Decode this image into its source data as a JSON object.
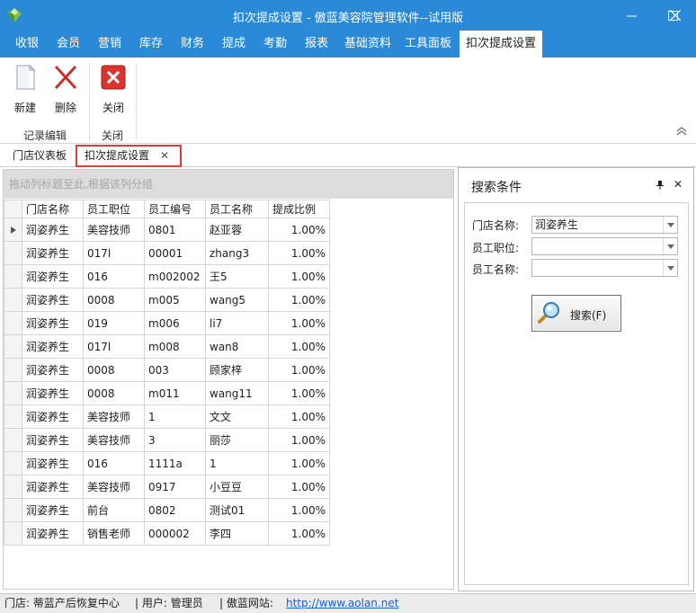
{
  "window": {
    "title": "扣次提成设置 - 傲蓝美容院管理软件--试用版"
  },
  "menu": {
    "items": [
      "收银",
      "会员",
      "营销",
      "库存",
      "财务",
      "提成",
      "考勤",
      "报表",
      "基础资料",
      "工具面板",
      "扣次提成设置"
    ],
    "active": "扣次提成设置"
  },
  "ribbon": {
    "new_label": "新建",
    "delete_label": "删除",
    "close_label": "关闭",
    "group_edit": "记录编辑",
    "group_close": "关闭"
  },
  "doctabs": {
    "dashboard": "门店仪表板",
    "active": "扣次提成设置",
    "close_glyph": "✕"
  },
  "grid": {
    "group_hint": "拖动列标题至此,根据该列分组",
    "columns": [
      "门店名称",
      "员工职位",
      "员工编号",
      "员工名称",
      "提成比例"
    ],
    "rows": [
      [
        "润姿养生",
        "美容技师",
        "0801",
        "赵亚蓉",
        "1.00%"
      ],
      [
        "润姿养生",
        "017l",
        "00001",
        "zhang3",
        "1.00%"
      ],
      [
        "润姿养生",
        "016",
        "m002002",
        "王5",
        "1.00%"
      ],
      [
        "润姿养生",
        "0008",
        "m005",
        "wang5",
        "1.00%"
      ],
      [
        "润姿养生",
        "019",
        "m006",
        "li7",
        "1.00%"
      ],
      [
        "润姿养生",
        "017l",
        "m008",
        "wan8",
        "1.00%"
      ],
      [
        "润姿养生",
        "0008",
        "003",
        "顾家梓",
        "1.00%"
      ],
      [
        "润姿养生",
        "0008",
        "m011",
        "wang11",
        "1.00%"
      ],
      [
        "润姿养生",
        "美容技师",
        "1",
        "文文",
        "1.00%"
      ],
      [
        "润姿养生",
        "美容技师",
        "3",
        "丽莎",
        "1.00%"
      ],
      [
        "润姿养生",
        "016",
        "1111a",
        "1",
        "1.00%"
      ],
      [
        "润姿养生",
        "美容技师",
        "0917",
        "小豆豆",
        "1.00%"
      ],
      [
        "润姿养生",
        "前台",
        "0802",
        "测试01",
        "1.00%"
      ],
      [
        "润姿养生",
        "销售老师",
        "000002",
        "李四",
        "1.00%"
      ]
    ]
  },
  "search": {
    "title": "搜索条件",
    "close_glyph": "✕",
    "store_label": "门店名称:",
    "store_value": "润姿养生",
    "position_label": "员工职位:",
    "position_value": "",
    "name_label": "员工名称:",
    "name_value": "",
    "button_label": "搜索(F)"
  },
  "status": {
    "store": "门店:  蒂蓝产后恢复中心",
    "user": "| 用户:  管理员",
    "site_label": "| 傲蓝网站:",
    "site_url": "http://www.aolan.net"
  },
  "colors": {
    "accent": "#2b8ad8",
    "highlight_border": "#e23b3b",
    "link": "#1e5fd0"
  }
}
